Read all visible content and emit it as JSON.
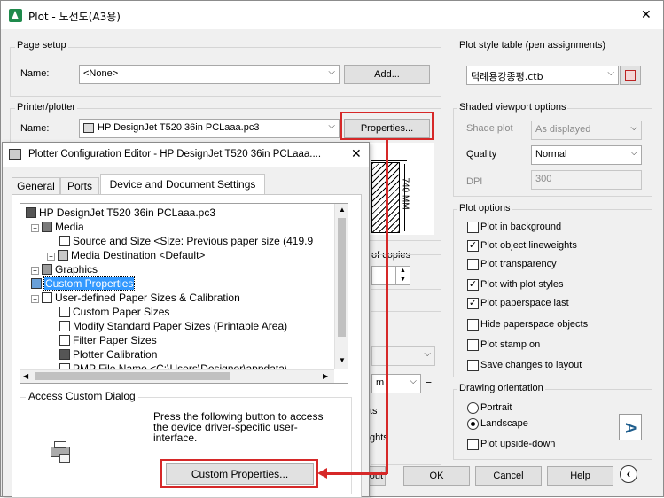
{
  "window": {
    "title": "Plot - 노선도(A3용)",
    "close_glyph": "✕"
  },
  "page_setup": {
    "group_label": "Page setup",
    "name_label": "Name:",
    "name_value": "<None>",
    "add_button": "Add..."
  },
  "printer": {
    "group_label": "Printer/plotter",
    "name_label": "Name:",
    "name_value": "HP DesignJet T520 36in PCLaaa.pc3",
    "properties_button": "Properties...",
    "dimension_text": "740 MM"
  },
  "plot_style": {
    "group_label": "Plot style table (pen assignments)",
    "value": "덕례용강종평.ctb"
  },
  "shaded": {
    "group_label": "Shaded viewport options",
    "shade_label": "Shade plot",
    "shade_value": "As displayed",
    "quality_label": "Quality",
    "quality_value": "Normal",
    "dpi_label": "DPI",
    "dpi_value": "300"
  },
  "plot_options": {
    "group_label": "Plot options",
    "items": [
      {
        "label": "Plot in background",
        "checked": false
      },
      {
        "label": "Plot object lineweights",
        "checked": true
      },
      {
        "label": "Plot transparency",
        "checked": false
      },
      {
        "label": "Plot with plot styles",
        "checked": true
      },
      {
        "label": "Plot paperspace last",
        "checked": true
      },
      {
        "label": "Hide paperspace objects",
        "checked": false
      },
      {
        "label": "Plot stamp on",
        "checked": false
      },
      {
        "label": "Save changes to layout",
        "checked": false
      }
    ]
  },
  "orientation": {
    "group_label": "Drawing orientation",
    "portrait": "Portrait",
    "landscape": "Landscape",
    "upside_down": "Plot upside-down",
    "icon_letter": "A"
  },
  "behind": {
    "copies_label": "of copies",
    "fragment_ts": "ts",
    "fragment_ghts": "ghts",
    "fragment_m": "m",
    "fragment_eq": "=",
    "fragment_apply": "out"
  },
  "footer": {
    "ok": "OK",
    "cancel": "Cancel",
    "help": "Help",
    "expand_glyph": "‹"
  },
  "editor": {
    "title": "Plotter Configuration Editor - HP DesignJet T520 36in PCLaaa....",
    "close_glyph": "✕",
    "tabs": [
      "General",
      "Ports",
      "Device and Document Settings"
    ],
    "tree": [
      {
        "label": "HP DesignJet T520 36in PCLaaa.pc3",
        "indent": 0,
        "exp": "",
        "icon": "printer-icon"
      },
      {
        "label": "Media",
        "indent": 1,
        "exp": "−",
        "icon": "media-icon"
      },
      {
        "label": "Source and Size <Size: Previous paper size (419.9",
        "indent": 3,
        "exp": "",
        "icon": "paper-icon"
      },
      {
        "label": "Media Destination <Default>",
        "indent": 2,
        "exp": "+",
        "icon": "pen-icon"
      },
      {
        "label": "Graphics",
        "indent": 1,
        "exp": "+",
        "icon": "graphics-icon"
      },
      {
        "label": "Custom Properties",
        "indent": 1,
        "exp": "",
        "icon": "custom-icon",
        "selected": true
      },
      {
        "label": "User-defined Paper Sizes & Calibration",
        "indent": 1,
        "exp": "−",
        "icon": "doc-icon"
      },
      {
        "label": "Custom Paper Sizes",
        "indent": 3,
        "exp": "",
        "icon": "paper-icon"
      },
      {
        "label": "Modify Standard Paper Sizes (Printable Area)",
        "indent": 3,
        "exp": "",
        "icon": "paper-icon"
      },
      {
        "label": "Filter Paper Sizes",
        "indent": 3,
        "exp": "",
        "icon": "paper-icon"
      },
      {
        "label": "Plotter Calibration",
        "indent": 3,
        "exp": "",
        "icon": "printer-icon"
      },
      {
        "label": "PMP File Name <C:\\Users\\Designer\\appdata\\",
        "indent": 3,
        "exp": "",
        "icon": "paper-icon"
      }
    ],
    "access_label": "Access Custom Dialog",
    "access_text": "Press the following button to access the device driver-specific user-interface.",
    "custom_button": "Custom Properties..."
  }
}
